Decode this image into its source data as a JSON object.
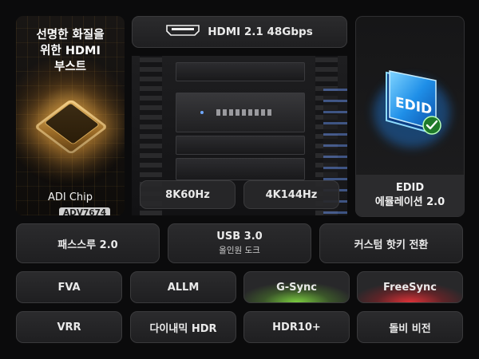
{
  "chip_panel": {
    "title": "선명한 화질을\n위한 HDMI\n부스트",
    "chip_name": "ADI Chip",
    "chip_model": "ADV7674"
  },
  "hdmi_label": "HDMI 2.1 48Gbps",
  "resolutions": [
    "8K60Hz",
    "4K144Hz"
  ],
  "edid": {
    "line1": "EDID",
    "line2": "에뮬레이션 2.0",
    "icon_text": "EDID"
  },
  "features_row1": {
    "passthrough": "패스스루 2.0",
    "usb_title": "USB 3.0",
    "usb_sub": "올인원 도크",
    "hotkey": "커스텀 핫키 전환"
  },
  "features_row2": [
    "FVA",
    "ALLM",
    "G-Sync",
    "FreeSync"
  ],
  "features_row3": [
    "VRR",
    "다이내믹 HDR",
    "HDR10+",
    "돌비 비전"
  ],
  "colors": {
    "gsync_glow": "#7fd640",
    "freesync_glow": "#e0353a",
    "edid_blue": "#2aa9ff",
    "edid_check": "#39c24a"
  }
}
